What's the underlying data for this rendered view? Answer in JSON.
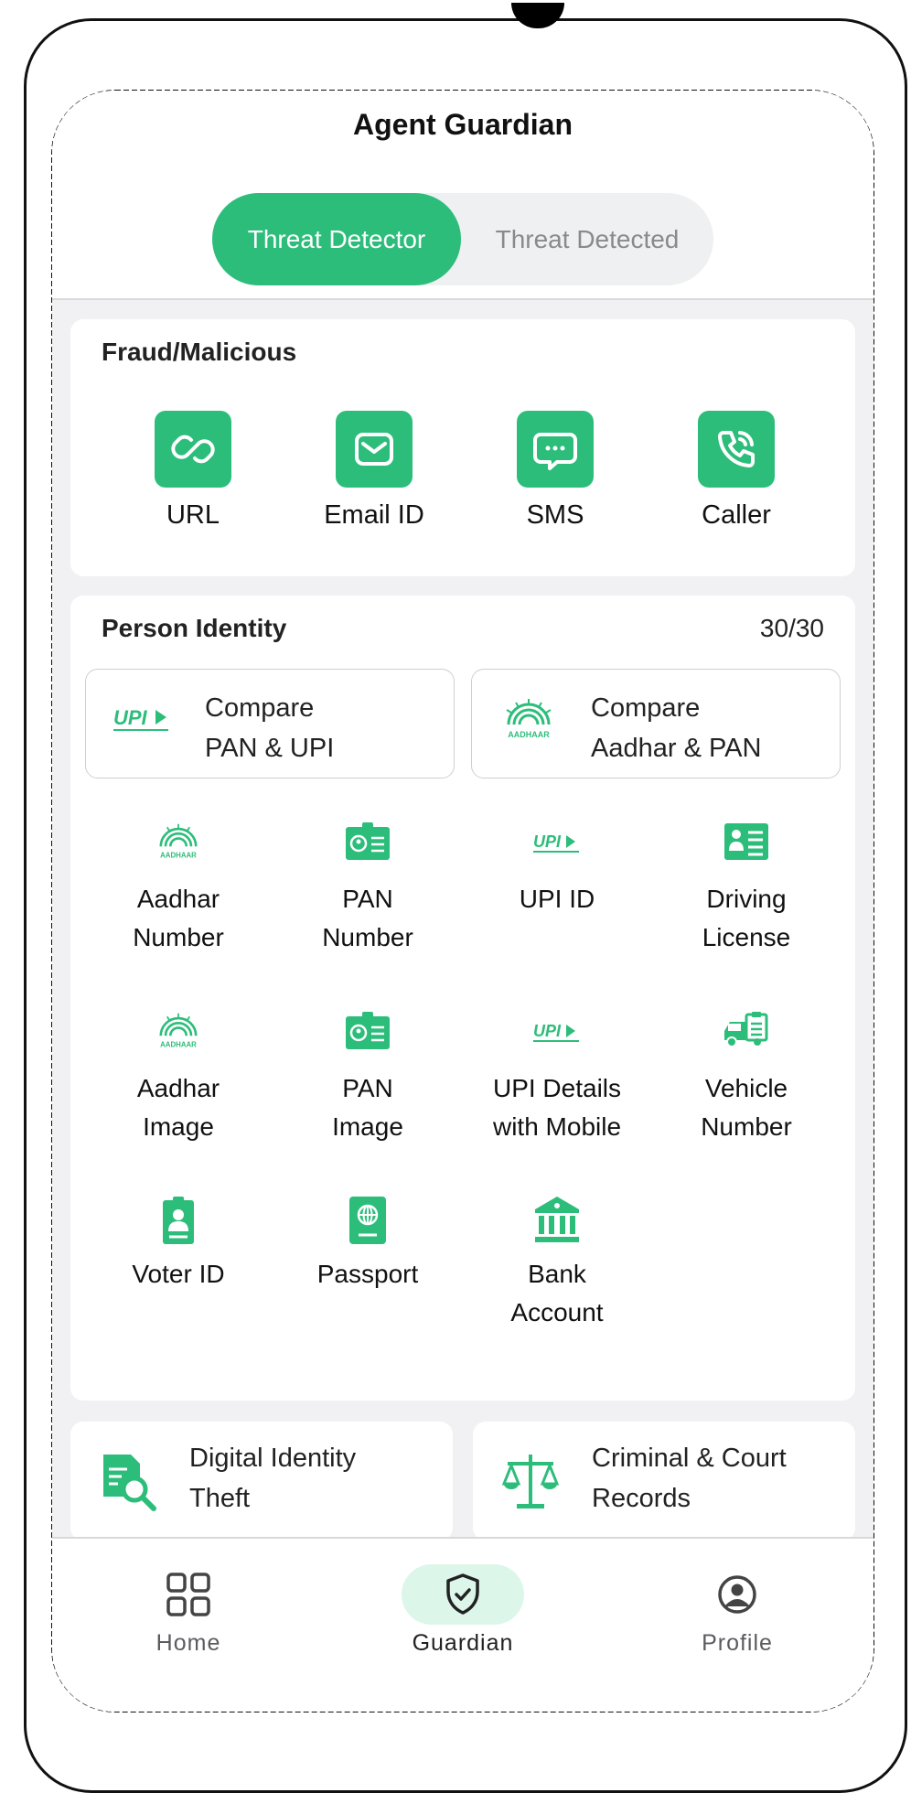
{
  "app": {
    "title": "Agent Guardian"
  },
  "segments": {
    "active": "Threat Detector",
    "inactive": "Threat Detected"
  },
  "fraud": {
    "title": "Fraud/Malicious",
    "items": [
      {
        "label": "URL",
        "icon": "link-icon"
      },
      {
        "label": "Email ID",
        "icon": "mail-icon"
      },
      {
        "label": "SMS",
        "icon": "chat-icon"
      },
      {
        "label": "Caller",
        "icon": "phone-icon"
      }
    ]
  },
  "identity": {
    "title": "Person Identity",
    "count": "30/30",
    "compare": [
      {
        "line1": "Compare",
        "line2": "PAN & UPI",
        "icon": "upi-logo"
      },
      {
        "line1": "Compare",
        "line2": "Aadhar & PAN",
        "icon": "aadhaar-logo"
      }
    ],
    "items": [
      {
        "line1": "Aadhar",
        "line2": "Number",
        "icon": "aadhaar-icon"
      },
      {
        "line1": "PAN",
        "line2": "Number",
        "icon": "id-card-icon"
      },
      {
        "line1": "UPI ID",
        "line2": "",
        "icon": "upi-icon"
      },
      {
        "line1": "Driving",
        "line2": "License",
        "icon": "license-icon"
      },
      {
        "line1": "Aadhar",
        "line2": "Image",
        "icon": "aadhaar-icon"
      },
      {
        "line1": "PAN",
        "line2": "Image",
        "icon": "id-card-icon"
      },
      {
        "line1": "UPI Details",
        "line2": "with Mobile",
        "icon": "upi-icon"
      },
      {
        "line1": "Vehicle",
        "line2": "Number",
        "icon": "vehicle-icon"
      },
      {
        "line1": "Voter ID",
        "line2": "",
        "icon": "voter-id-icon"
      },
      {
        "line1": "Passport",
        "line2": "",
        "icon": "passport-icon"
      },
      {
        "line1": "Bank",
        "line2": "Account",
        "icon": "bank-icon"
      }
    ]
  },
  "bottom_cards": [
    {
      "line1": "Digital Identity",
      "line2": "Theft",
      "icon": "document-search-icon"
    },
    {
      "line1": "Criminal & Court",
      "line2": "Records",
      "icon": "scales-icon"
    }
  ],
  "nav": [
    {
      "label": "Home",
      "icon": "grid-icon"
    },
    {
      "label": "Guardian",
      "icon": "shield-check-icon"
    },
    {
      "label": "Profile",
      "icon": "user-circle-icon"
    }
  ],
  "colors": {
    "accent": "#2dbd7b",
    "accent_light": "#dcf6e9",
    "background": "#f1f1f3"
  }
}
